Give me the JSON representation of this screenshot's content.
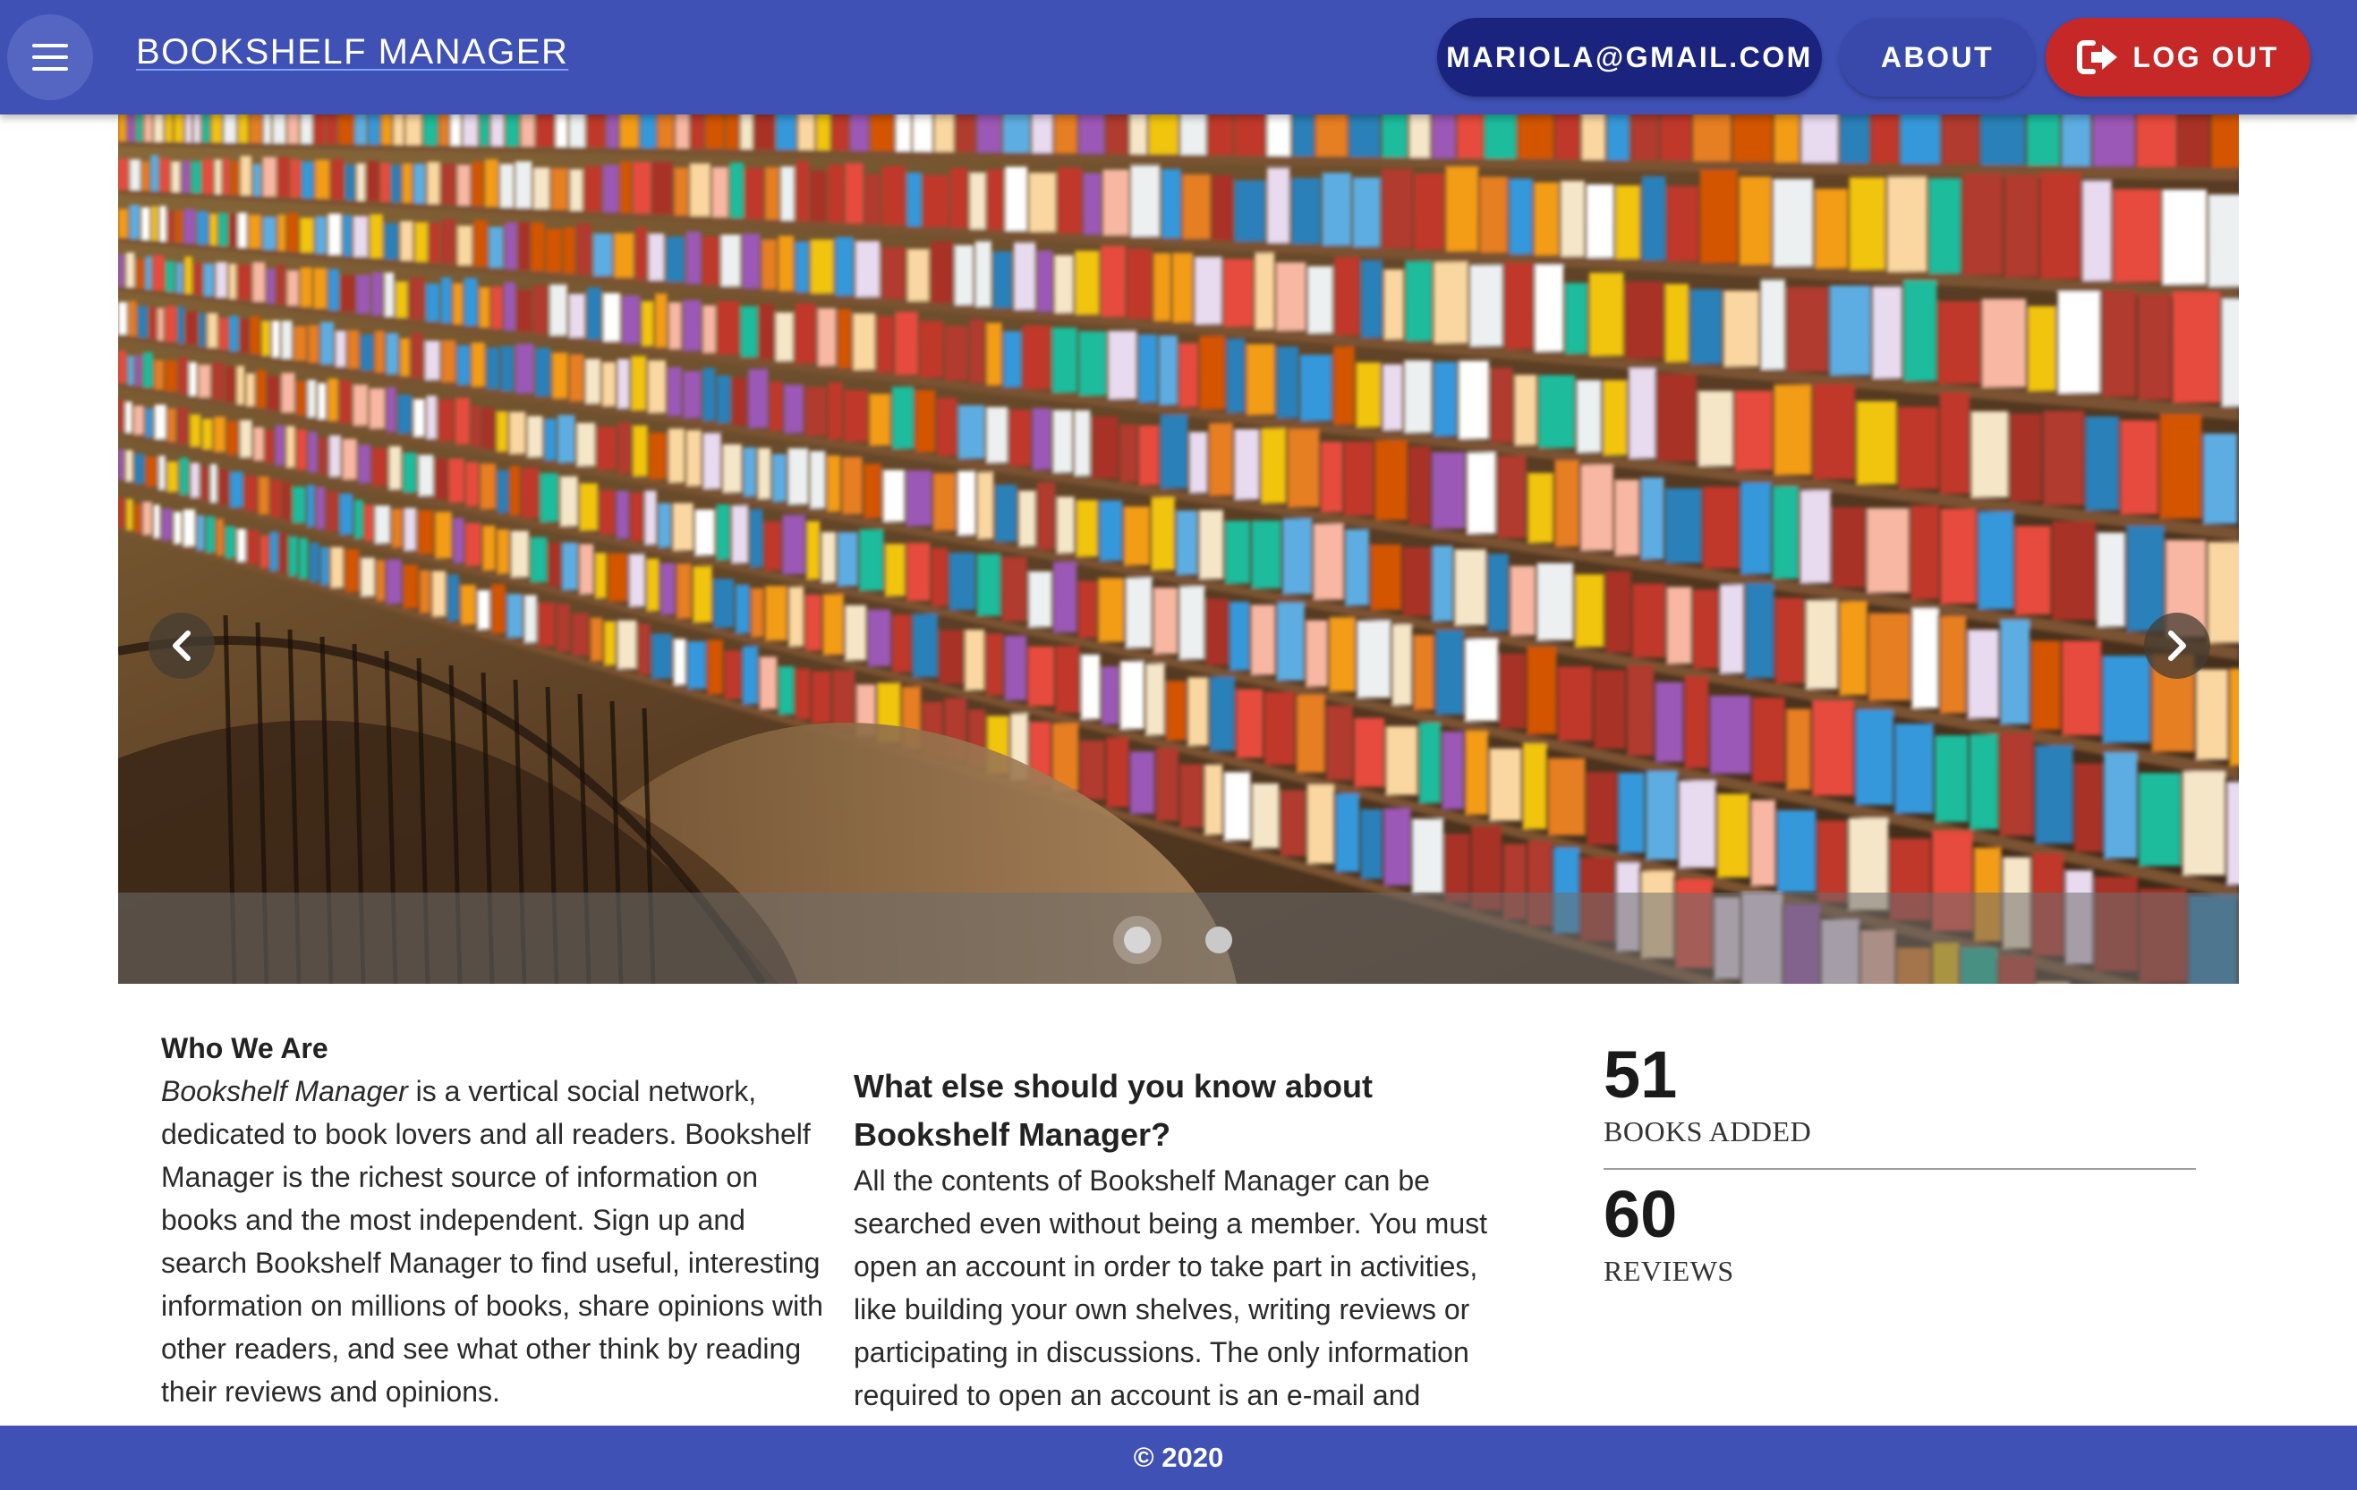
{
  "header": {
    "title": "BOOKSHELF MANAGER",
    "user_email": "MARIOLA@GMAIL.COM",
    "about_label": "ABOUT",
    "logout_label": "LOG OUT",
    "menu_icon": "menu-icon",
    "logout_icon": "sign-out-icon",
    "bar_color": "#3f51b5"
  },
  "carousel": {
    "image": "library-bookshelves-photo",
    "prev_icon": "chevron-left-icon",
    "next_icon": "chevron-right-icon",
    "slide_count": 2,
    "active_slide": 1
  },
  "about": {
    "who_heading": "Who We Are",
    "who_brand": "Bookshelf Manager",
    "who_text": " is a vertical social network, dedicated to book lovers and all readers. Bookshelf Manager is the richest source of information on books and the most independent. Sign up and search Bookshelf Manager to find useful, interesting information on millions of books, share opinions with other readers, and see what other think by reading their reviews and opinions.",
    "what_heading": "What else should you know about Bookshelf Manager?",
    "what_text": "All the contents of Bookshelf Manager can be searched even without being a member. You must open an account in order to take part in activities, like building your own shelves, writing reviews or participating in discussions. The only information required to open an account is an e-mail and"
  },
  "stats": [
    {
      "value": "51",
      "label": "BOOKS ADDED"
    },
    {
      "value": "60",
      "label": "REVIEWS"
    }
  ],
  "footer": {
    "text": "© 2020"
  }
}
